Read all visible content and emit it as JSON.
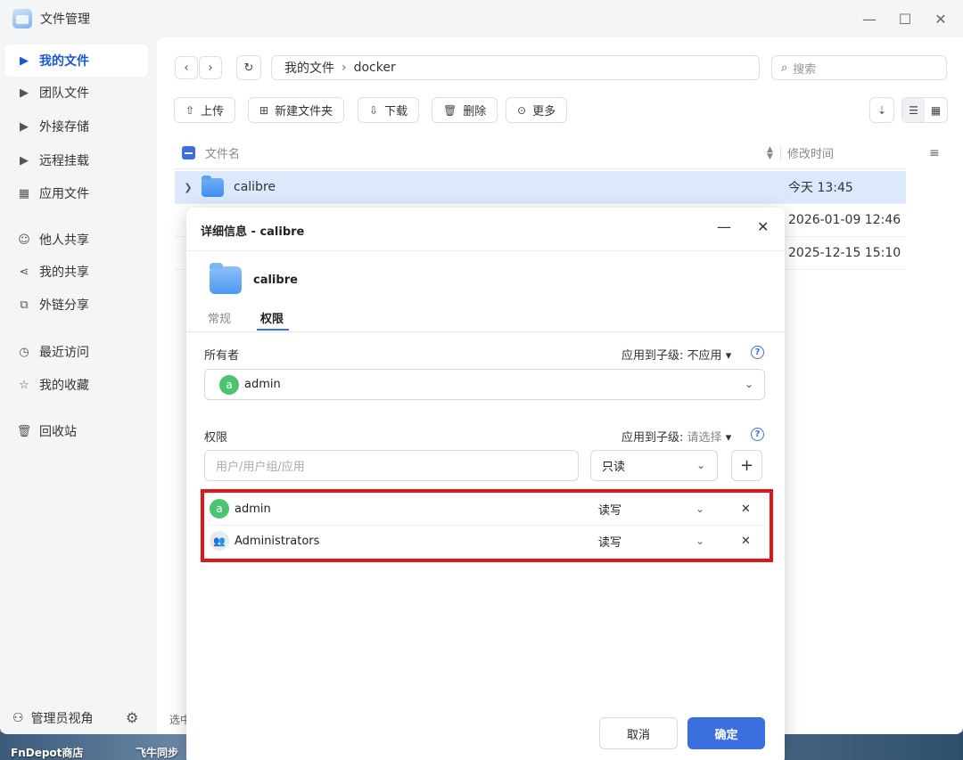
{
  "window": {
    "title": "文件管理"
  },
  "sidebar": {
    "items": [
      {
        "label": "我的文件",
        "icon": "caret-right-icon"
      },
      {
        "label": "团队文件",
        "icon": "caret-right-icon"
      },
      {
        "label": "外接存储",
        "icon": "caret-right-icon"
      },
      {
        "label": "远程挂载",
        "icon": "caret-right-icon"
      },
      {
        "label": "应用文件",
        "icon": "grid-icon"
      },
      {
        "label": "他人共享",
        "icon": "user-icon"
      },
      {
        "label": "我的共享",
        "icon": "share-icon"
      },
      {
        "label": "外链分享",
        "icon": "external-link-icon"
      },
      {
        "label": "最近访问",
        "icon": "clock-icon"
      },
      {
        "label": "我的收藏",
        "icon": "star-icon"
      },
      {
        "label": "回收站",
        "icon": "trash-icon"
      }
    ],
    "admin_view": "管理员视角"
  },
  "path": {
    "root": "我的文件",
    "current": "docker"
  },
  "search": {
    "placeholder": "搜索"
  },
  "toolbar": {
    "upload": "上传",
    "new_folder": "新建文件夹",
    "download": "下载",
    "delete": "删除",
    "more": "更多"
  },
  "list": {
    "col_name": "文件名",
    "col_mtime": "修改时间",
    "rows": [
      {
        "name": "calibre",
        "mtime": "今天 13:45"
      },
      {
        "name": "",
        "mtime": "2026-01-09 12:46"
      },
      {
        "name": "",
        "mtime": "2025-12-15 15:10"
      }
    ]
  },
  "footer": {
    "status": "选中"
  },
  "dialog": {
    "title": "详细信息 - calibre",
    "name": "calibre",
    "tabs": [
      "常规",
      "权限"
    ],
    "owner_label": "所有者",
    "apply_label": "应用到子级:",
    "owner_apply_value": "不应用",
    "owner": {
      "avatar": "a",
      "name": "admin"
    },
    "perm_label": "权限",
    "perm_apply_value": "请选择",
    "user_input_placeholder": "用户/用户组/应用",
    "perm_select_value": "只读",
    "entries": [
      {
        "avatar": "a",
        "name": "admin",
        "level": "读写"
      },
      {
        "avatar": "",
        "name": "Administrators",
        "level": "读写"
      }
    ],
    "cancel": "取消",
    "ok": "确定"
  },
  "desktop": {
    "label_left": "FnDepot商店",
    "label_right": "飞牛同步"
  },
  "colors": {
    "accent": "#3b6fe0",
    "highlight": "#e0161a",
    "selected_row": "#dce8fb"
  }
}
